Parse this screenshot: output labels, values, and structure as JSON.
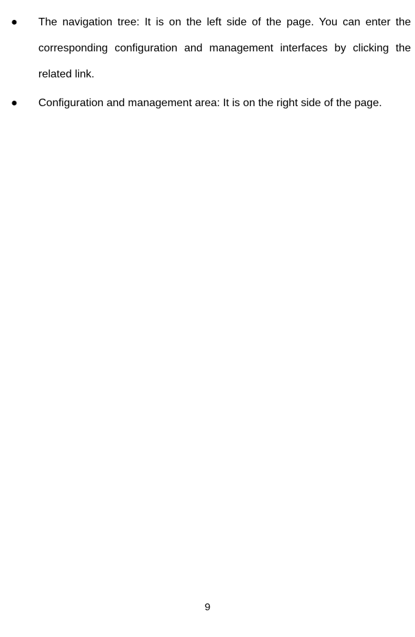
{
  "bullets": [
    {
      "marker": "●",
      "text": "The navigation tree: It is on the left side of the page. You can enter the corresponding configuration and management interfaces by clicking the related link."
    },
    {
      "marker": "●",
      "text": "Configuration and management area: It is on the right side of the page."
    }
  ],
  "page_number": "9"
}
